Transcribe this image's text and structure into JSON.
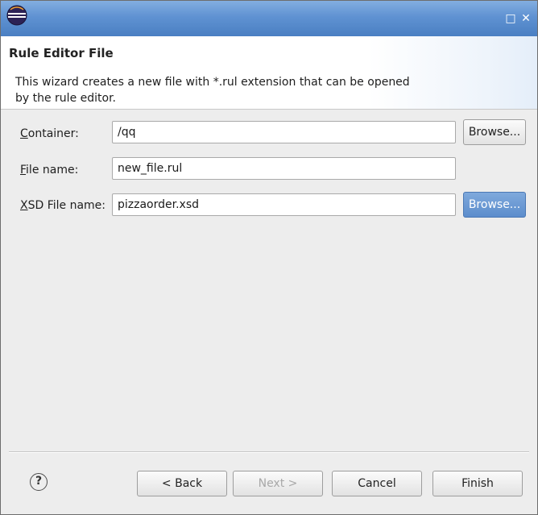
{
  "window": {
    "title_icon": "eclipse-icon",
    "maximize_glyph": "□",
    "close_glyph": "✕"
  },
  "banner": {
    "title": "Rule Editor File",
    "description": "This wizard creates a new file with *.rul extension that can be opened by the rule editor."
  },
  "form": {
    "container": {
      "mnemonic": "C",
      "label_rest": "ontainer:",
      "value": "/qq",
      "browse_label": "Browse..."
    },
    "file_name": {
      "mnemonic": "F",
      "label_rest": "ile name:",
      "value": "new_file.rul"
    },
    "xsd_file_name": {
      "mnemonic": "X",
      "label_rest": "SD File name:",
      "value": "pizzaorder.xsd",
      "browse_label": "Browse..."
    }
  },
  "footer": {
    "help_glyph": "?",
    "back_label": "< Back",
    "next_label": "Next >",
    "cancel_label": "Cancel",
    "finish_label": "Finish"
  },
  "colors": {
    "titlebar": "#5f92d2",
    "focused_button": "#6a99d4",
    "background": "#ededed"
  }
}
